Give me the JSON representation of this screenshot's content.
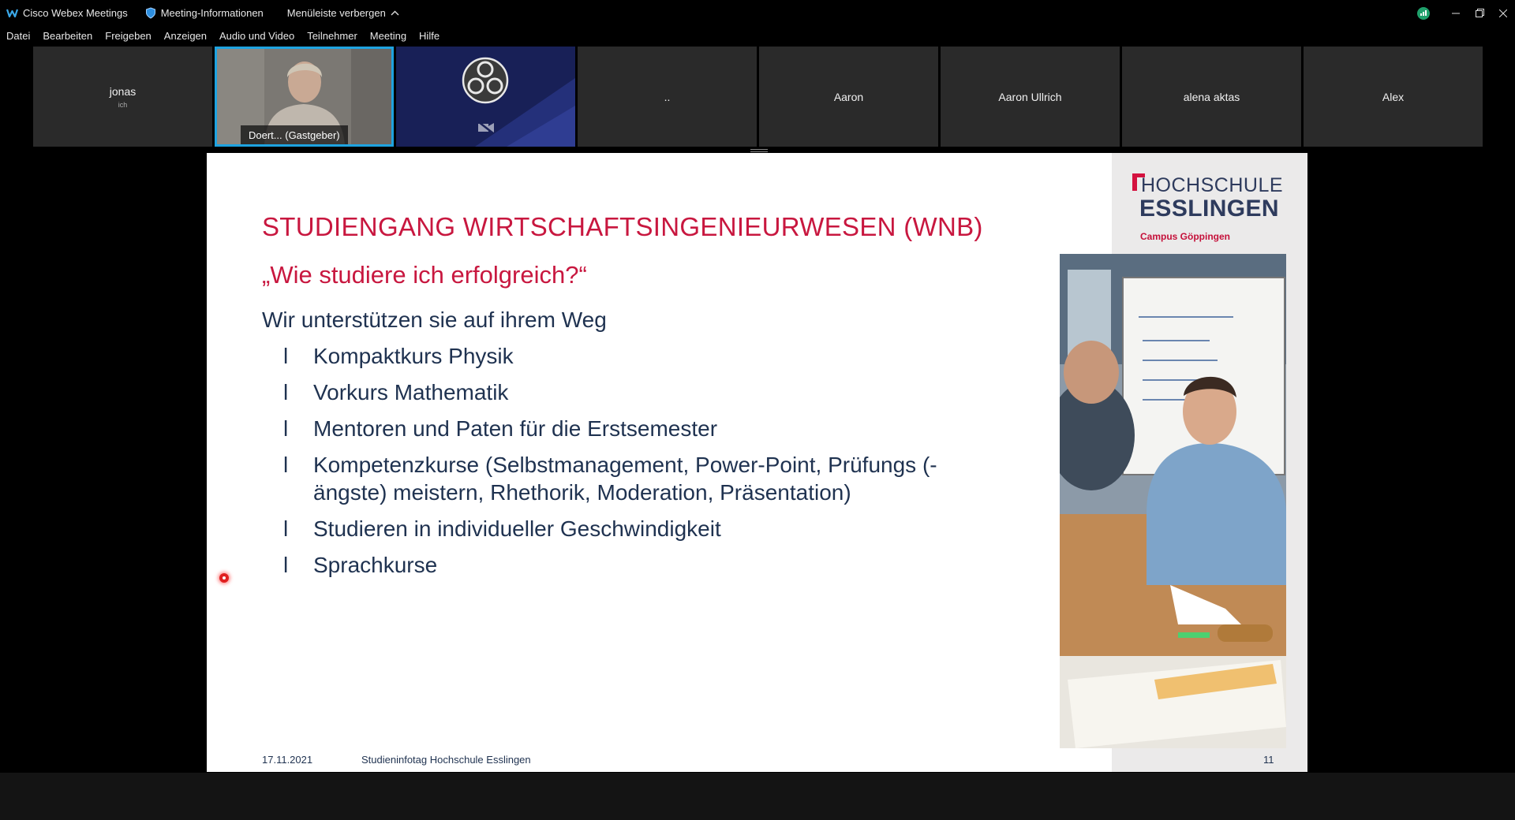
{
  "titlebar": {
    "app_title": "Cisco Webex Meetings",
    "meeting_info": "Meeting-Informationen",
    "hide_menu": "Menüleiste verbergen"
  },
  "menu": [
    "Datei",
    "Bearbeiten",
    "Freigeben",
    "Anzeigen",
    "Audio und Video",
    "Teilnehmer",
    "Meeting",
    "Hilfe"
  ],
  "participants": [
    {
      "name": "jonas",
      "sub": "ich"
    },
    {
      "name": "Doert...  (Gastgeber)",
      "video": true
    },
    {
      "name": "",
      "obs": true
    },
    {
      "name": ".."
    },
    {
      "name": "Aaron"
    },
    {
      "name": "Aaron Ullrich"
    },
    {
      "name": "alena aktas"
    },
    {
      "name": "Alex"
    }
  ],
  "slide": {
    "logo_line1": "HOCHSCHULE",
    "logo_line2": "ESSLINGEN",
    "logo_line3": "Campus Göppingen",
    "title": "STUDIENGANG WIRTSCHAFTSINGENIEURWESEN (WNB)",
    "subtitle": "„Wie studiere ich erfolgreich?“",
    "lead": "Wir unterstützen sie auf ihrem Weg",
    "bullet_mark": "l",
    "bullets": [
      "Kompaktkurs Physik",
      "Vorkurs Mathematik",
      "Mentoren und Paten für die Erstsemester",
      "Kompetenzkurse (Selbstmanagement,  Power-Point, Prüfungs (-ängste) meistern, Rhethorik, Moderation, Präsentation)",
      "Studieren in individueller Geschwindigkeit",
      "Sprachkurse"
    ],
    "footer_date": "17.11.2021",
    "footer_title": "Studieninfotag Hochschule Esslingen",
    "page_number": "11"
  },
  "colors": {
    "accent_red": "#c8173f",
    "text_navy": "#1f3250",
    "active_speaker_border": "#1ea3e0"
  }
}
